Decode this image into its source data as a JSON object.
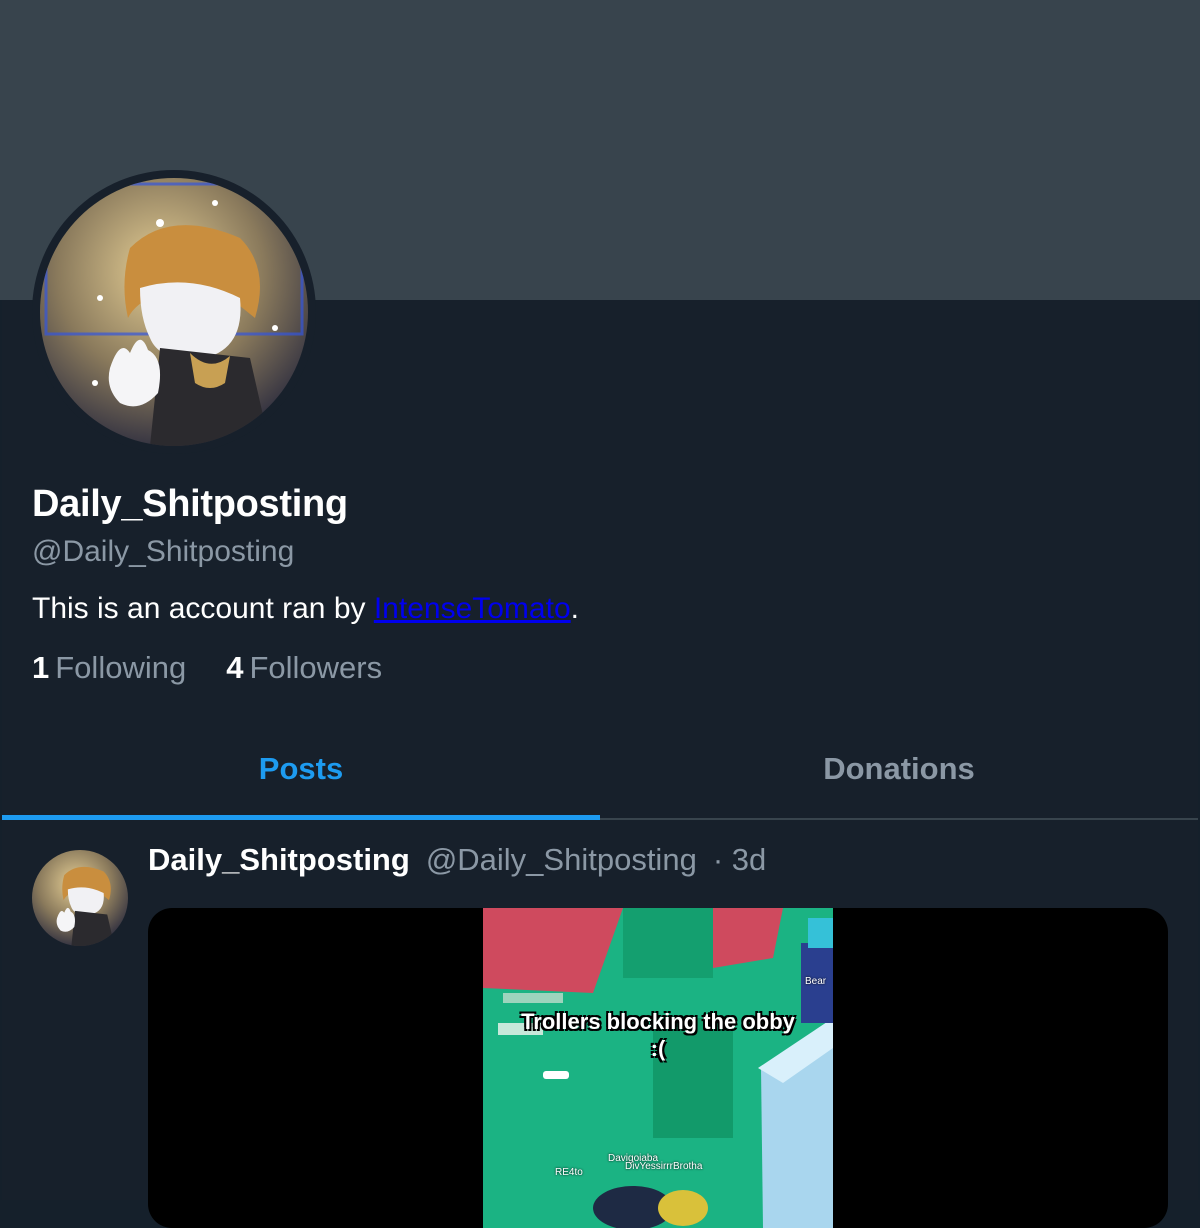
{
  "profile": {
    "display_name": "Daily_Shitposting",
    "handle": "@Daily_Shitposting",
    "bio_prefix": "This is an account ran by ",
    "bio_link": "IntenseTomato",
    "bio_suffix": ".",
    "following_count": "1",
    "following_label": "Following",
    "followers_count": "4",
    "followers_label": "Followers"
  },
  "tabs": [
    {
      "label": "Posts",
      "active": true
    },
    {
      "label": "Donations",
      "active": false
    }
  ],
  "post": {
    "author_name": "Daily_Shitposting",
    "author_handle": "@Daily_Shitposting",
    "time": "· 3d",
    "video_caption_line1": "Trollers blocking the obby",
    "video_caption_line2": ":(",
    "video_tags": [
      "Bear",
      "Davigoiaba",
      "DivYessirrrBrotha",
      "RE4to"
    ]
  },
  "colors": {
    "accent": "#1d9bf0",
    "link": "#0000ee",
    "muted": "#8b98a5",
    "banner": "#38444d",
    "background": "#15202b"
  }
}
